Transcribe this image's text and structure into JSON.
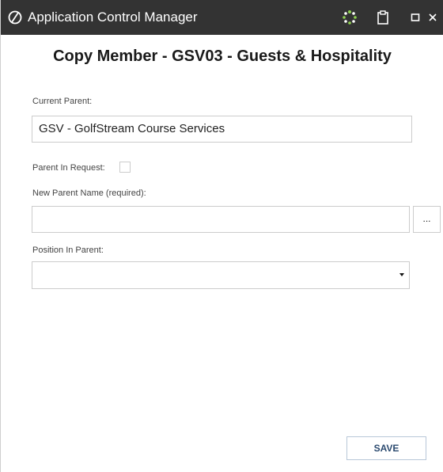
{
  "titlebar": {
    "app_title": "Application Control Manager",
    "icons": [
      "app-logo-icon",
      "spinner-icon",
      "clipboard-icon",
      "maximize-icon",
      "close-icon"
    ],
    "background": "#333333"
  },
  "dialog": {
    "title": "Copy Member - GSV03 - Guests & Hospitality"
  },
  "form": {
    "current_parent_label": "Current Parent:",
    "current_parent_value": "GSV - GolfStream Course Services",
    "parent_in_request_label": "Parent In Request:",
    "parent_in_request_checked": false,
    "new_parent_label": "New Parent Name (required):",
    "new_parent_value": "",
    "browse_label": "...",
    "position_label": "Position In Parent:",
    "position_value": ""
  },
  "actions": {
    "save_label": "SAVE"
  }
}
